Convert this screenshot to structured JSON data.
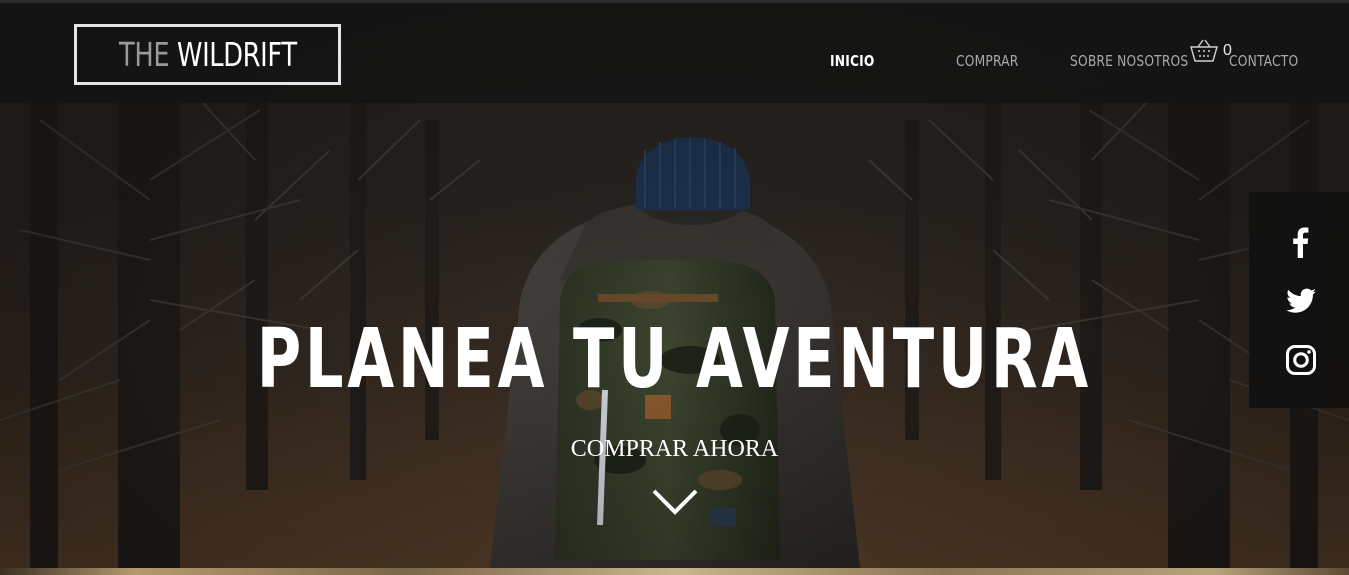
{
  "brand": {
    "the": "THE",
    "name": "WILDRIFT"
  },
  "nav": {
    "items": [
      {
        "label": "INICIO",
        "active": true
      },
      {
        "label": "COMPRAR",
        "active": false
      },
      {
        "label": "SOBRE NOSOTROS",
        "active": false
      },
      {
        "label": "CONTACTO",
        "active": false
      }
    ]
  },
  "cart": {
    "icon": "shopping-basket-icon",
    "count": "0"
  },
  "hero": {
    "headline": "PLANEA TU AVENTURA",
    "cta": "COMPRAR AHORA",
    "scroll_icon": "chevron-down-icon"
  },
  "social": {
    "links": [
      {
        "icon": "facebook-icon"
      },
      {
        "icon": "twitter-icon"
      },
      {
        "icon": "instagram-icon"
      }
    ]
  },
  "colors": {
    "header_bg": "#141414",
    "nav_active": "#ffffff",
    "nav_inactive": "#a9a9a9",
    "social_bg": "#111111"
  }
}
